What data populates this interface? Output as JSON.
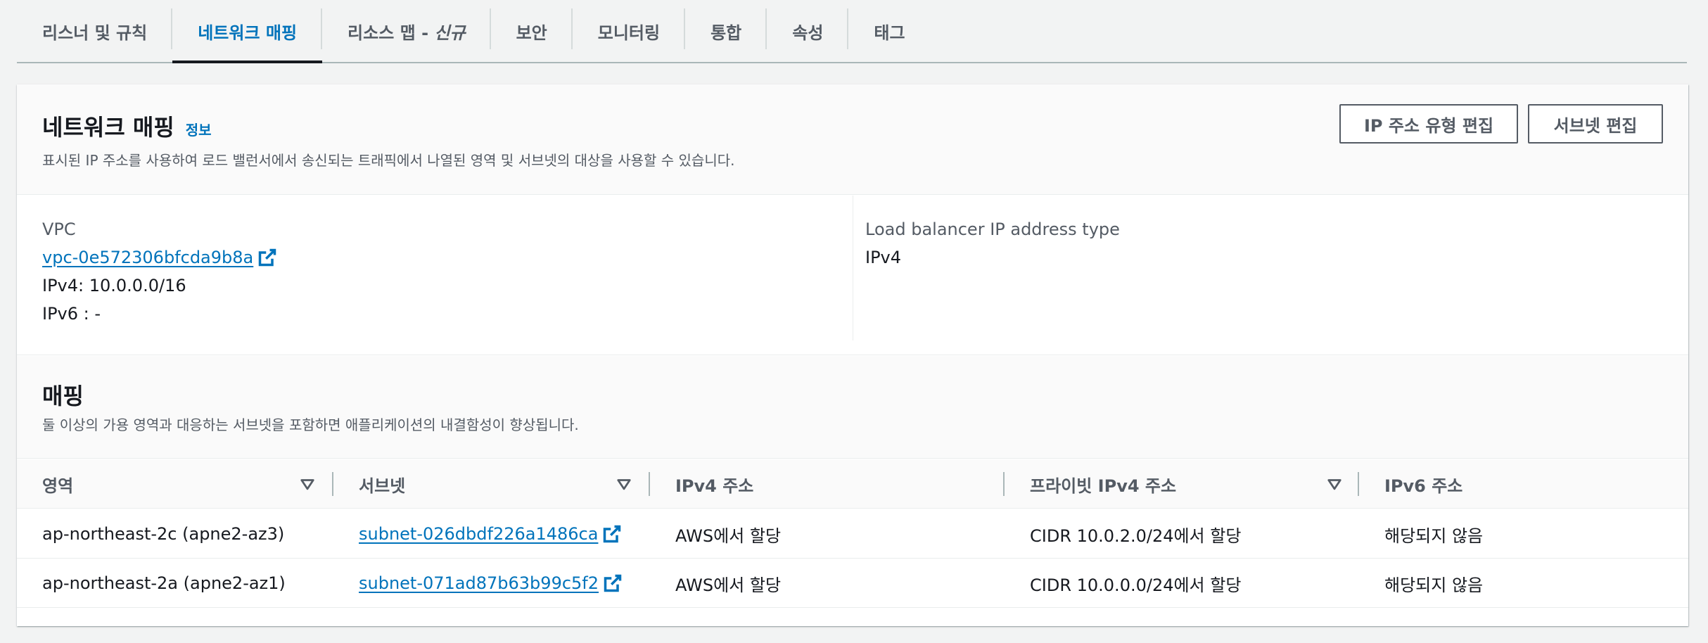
{
  "tabs": [
    {
      "label": "리스너 및 규칙",
      "suffix": "",
      "active": false
    },
    {
      "label": "네트워크 매핑",
      "suffix": "",
      "active": true
    },
    {
      "label": "리소스 맵 - ",
      "suffix": "신규",
      "active": false
    },
    {
      "label": "보안",
      "suffix": "",
      "active": false
    },
    {
      "label": "모니터링",
      "suffix": "",
      "active": false
    },
    {
      "label": "통합",
      "suffix": "",
      "active": false
    },
    {
      "label": "속성",
      "suffix": "",
      "active": false
    },
    {
      "label": "태그",
      "suffix": "",
      "active": false
    }
  ],
  "panel": {
    "title": "네트워크 매핑",
    "info": "정보",
    "description": "표시된 IP 주소를 사용하여 로드 밸런서에서 송신되는 트래픽에서 나열된 영역 및 서브넷의 대상을 사용할 수 있습니다.",
    "btn_edit_ip": "IP 주소 유형 편집",
    "btn_edit_subnet": "서브넷 편집"
  },
  "details": {
    "vpc_label": "VPC",
    "vpc_id": "vpc-0e572306bfcda9b8a",
    "ipv4": "IPv4: 10.0.0.0/16",
    "ipv6": "IPv6 : -",
    "lb_ip_type_label": "Load balancer IP address type",
    "lb_ip_type_value": "IPv4"
  },
  "mapping": {
    "title": "매핑",
    "description": "둘 이상의 가용 영역과 대응하는 서브넷을 포함하면 애플리케이션의 내결함성이 향상됩니다.",
    "columns": [
      "영역",
      "서브넷",
      "IPv4 주소",
      "프라이빗 IPv4 주소",
      "IPv6 주소"
    ],
    "rows": [
      {
        "zone": "ap-northeast-2c (apne2-az3)",
        "subnet": "subnet-026dbdf226a1486ca",
        "ipv4": "AWS에서 할당",
        "private_ipv4": "CIDR 10.0.2.0/24에서 할당",
        "ipv6": "해당되지 않음"
      },
      {
        "zone": "ap-northeast-2a (apne2-az1)",
        "subnet": "subnet-071ad87b63b99c5f2",
        "ipv4": "AWS에서 할당",
        "private_ipv4": "CIDR 10.0.0.0/24에서 할당",
        "ipv6": "해당되지 않음"
      }
    ]
  },
  "colors": {
    "link": "#0073bb",
    "text": "#16191f",
    "muted": "#545b64",
    "background": "#f2f3f3"
  },
  "icons": [
    "external-link-icon",
    "sort-caret-down-icon"
  ]
}
